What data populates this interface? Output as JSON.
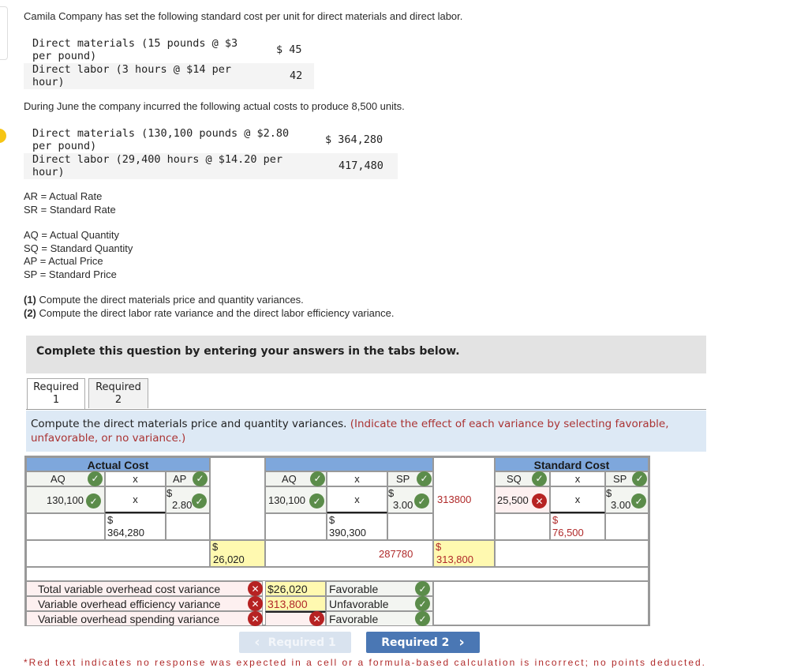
{
  "intro": "Camila Company has set the following standard cost per unit for direct materials and direct labor.",
  "standard_costs": [
    {
      "label_line1": "Direct materials (15 pounds @ $3",
      "label_line2": "per pound)",
      "amount": "$ 45"
    },
    {
      "label_line1": "Direct labor (3 hours @ $14 per",
      "label_line2": "hour)",
      "amount": "42"
    }
  ],
  "june_text": "During June the company incurred the following actual costs to produce 8,500 units.",
  "actual_costs": [
    {
      "label_line1": "Direct materials (130,100 pounds @ $2.80",
      "label_line2": "per pound)",
      "amount": "$ 364,280"
    },
    {
      "label_line1": "Direct labor (29,400 hours @ $14.20 per",
      "label_line2": "hour)",
      "amount": "417,480"
    }
  ],
  "definitions": {
    "group1": [
      "AR = Actual Rate",
      "SR = Standard Rate"
    ],
    "group2": [
      "AQ = Actual Quantity",
      "SQ = Standard Quantity",
      "AP = Actual Price",
      "SP = Standard Price"
    ]
  },
  "questions": [
    {
      "num": "(1)",
      "text": " Compute the direct materials price and quantity variances."
    },
    {
      "num": "(2)",
      "text": " Compute the direct labor rate variance and the direct labor efficiency variance."
    }
  ],
  "banner": "Complete this question by entering your answers in the tabs below.",
  "tabs": [
    {
      "line1": "Required",
      "line2": "1",
      "active": true
    },
    {
      "line1": "Required",
      "line2": "2",
      "active": false
    }
  ],
  "instruction": {
    "main": "Compute the direct materials price and quantity variances.",
    "note": "(Indicate the effect of each variance by selecting favorable, unfavorable, or no variance.)"
  },
  "worksheet": {
    "actual_cost": {
      "header": "Actual Cost",
      "col1_label": "AQ",
      "op": "x",
      "col3_label": "AP",
      "aq_value": "130,100",
      "ap_dollar": "$",
      "ap_value": "2.80",
      "total_dollar": "$",
      "total_value": "364,280"
    },
    "price_variance": {
      "dollar": "$",
      "value": "26,020"
    },
    "middle": {
      "header": "",
      "col1_label": "AQ",
      "op": "x",
      "col3_label": "SP",
      "aq_value": "130,100",
      "sp_dollar": "$",
      "sp_value": "3.00",
      "total_dollar": "$",
      "total_value": "390,300"
    },
    "middle_right_value": "313800",
    "mid_bottom_value": "287780",
    "quantity_variance": {
      "dollar": "$",
      "value": "313,800"
    },
    "standard_cost": {
      "header": "Standard Cost",
      "col1_label": "SQ",
      "op": "x",
      "col3_label": "SP",
      "sq_value": "25,500",
      "sp_dollar": "$",
      "sp_value": "3.00",
      "total_dollar": "$",
      "total_value": "76,500"
    },
    "summary": [
      {
        "label": "Total variable overhead cost variance",
        "amount": "$26,020",
        "effect": "Favorable"
      },
      {
        "label": "Variable overhead efficiency variance",
        "amount": "313,800",
        "effect": "Unfavorable"
      },
      {
        "label": "Variable overhead spending variance",
        "amount": "",
        "effect": "Favorable"
      }
    ]
  },
  "nav": {
    "prev": "Required 1",
    "next": "Required 2"
  },
  "footnote": "*Red text indicates no response was expected in a cell or a formula-based calculation is incorrect; no points deducted.",
  "icons": {
    "check": "✓",
    "cross": "✕",
    "chev_left": "‹",
    "chev_right": "›"
  }
}
